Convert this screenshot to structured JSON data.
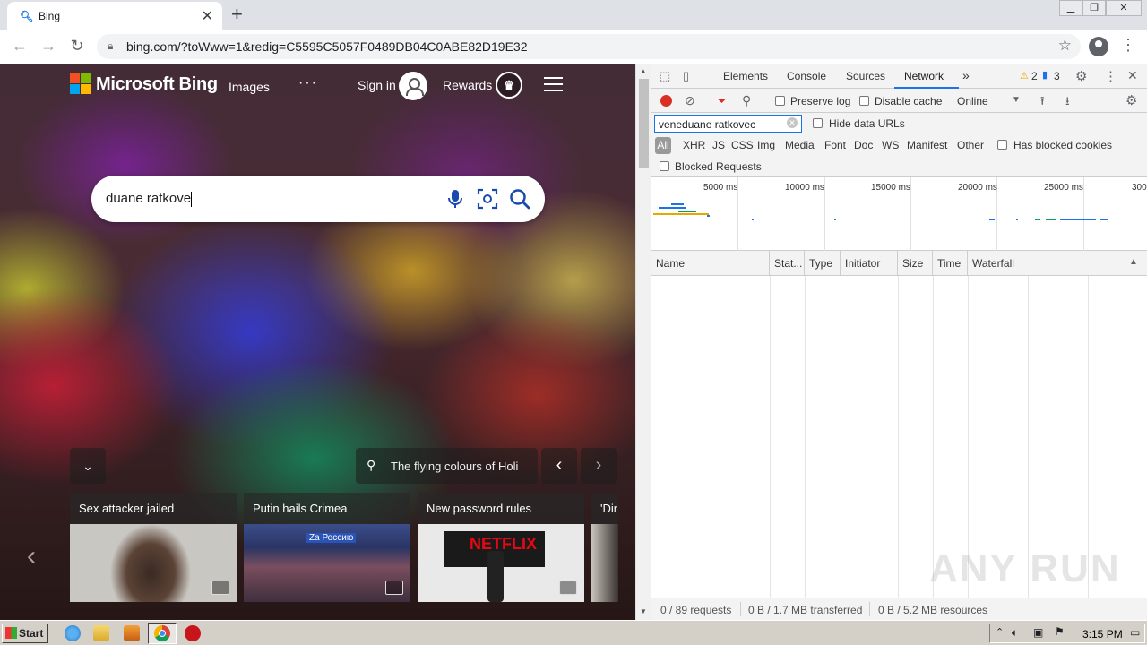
{
  "browser": {
    "tab": {
      "title": "Bing",
      "favicon": "magnifier-icon",
      "close": "✕"
    },
    "new_tab": "+",
    "url": "bing.com/?toWww=1&redig=C5595C5057F0489DB04C0ABE82D19E32",
    "window_controls": [
      "minimize",
      "restore",
      "close"
    ]
  },
  "bing": {
    "brand": "Microsoft Bing",
    "nav": {
      "images": "Images",
      "more": "···",
      "sign_in": "Sign in",
      "rewards": "Rewards"
    },
    "search": {
      "query": "duane ratkove"
    },
    "image_caption": "The flying colours of Holi",
    "news": [
      {
        "headline": "Sex attacker jailed"
      },
      {
        "headline": "Putin hails Crimea",
        "thumb_text": "Za Россию"
      },
      {
        "headline": "New password rules",
        "thumb_text": "NETFLIX"
      },
      {
        "headline": "'Dir"
      }
    ]
  },
  "devtools": {
    "tabs": [
      "Elements",
      "Console",
      "Sources",
      "Network"
    ],
    "active_tab": "Network",
    "more_tabs": "»",
    "warnings": "2",
    "messages": "3",
    "toolbar": {
      "preserve_log": "Preserve log",
      "disable_cache": "Disable cache",
      "throttle": "Online"
    },
    "filter": {
      "value": "veneduane ratkovec",
      "hide_data_urls": "Hide data URLs",
      "types": [
        "All",
        "XHR",
        "JS",
        "CSS",
        "Img",
        "Media",
        "Font",
        "Doc",
        "WS",
        "Manifest",
        "Other"
      ],
      "has_blocked_cookies": "Has blocked cookies",
      "blocked_requests": "Blocked Requests"
    },
    "overview_ticks": [
      "5000 ms",
      "10000 ms",
      "15000 ms",
      "20000 ms",
      "25000 ms",
      "300"
    ],
    "columns": [
      "Name",
      "Stat...",
      "Type",
      "Initiator",
      "Size",
      "Time",
      "Waterfall"
    ],
    "status": {
      "requests": "0 / 89 requests",
      "transferred": "0 B / 1.7 MB transferred",
      "resources": "0 B / 5.2 MB resources"
    },
    "watermark": "ANY RUN"
  },
  "taskbar": {
    "start": "Start",
    "clock": "3:15 PM"
  },
  "colors": {
    "accent": "#1a73e8",
    "record": "#d93025",
    "ms_red": "#f25022",
    "ms_green": "#7fba00",
    "ms_blue": "#00a4ef",
    "ms_yellow": "#ffb900"
  }
}
